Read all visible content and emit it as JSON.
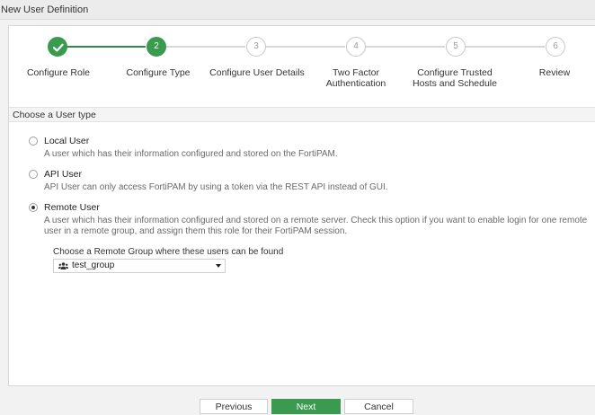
{
  "window": {
    "title": "New User Definition"
  },
  "stepper": {
    "steps": [
      {
        "number": "1",
        "label": "Configure Role",
        "state": "done"
      },
      {
        "number": "2",
        "label": "Configure Type",
        "state": "active"
      },
      {
        "number": "3",
        "label": "Configure User Details",
        "state": "todo"
      },
      {
        "number": "4",
        "label": "Two Factor\nAuthentication",
        "state": "todo"
      },
      {
        "number": "5",
        "label": "Configure Trusted\nHosts and Schedule",
        "state": "todo"
      },
      {
        "number": "6",
        "label": "Review",
        "state": "todo"
      }
    ]
  },
  "section": {
    "title": "Choose a User type"
  },
  "options": [
    {
      "label": "Local User",
      "description": "A user which has their information configured and stored on the FortiPAM.",
      "selected": false
    },
    {
      "label": "API User",
      "description": "API User can only access FortiPAM by using a token via the REST API instead of GUI.",
      "selected": false
    },
    {
      "label": "Remote User",
      "description": "A user which has their information configured and stored on a remote server. Check this option if you want to enable login for one remote user in a remote group, and assign them this role for their FortiPAM session.",
      "selected": true
    }
  ],
  "remote_group": {
    "label": "Choose a Remote Group where these users can be found",
    "selected_value": "test_group",
    "icon": "users-icon"
  },
  "buttons": {
    "previous": "Previous",
    "next": "Next",
    "cancel": "Cancel"
  },
  "colors": {
    "accent_green": "#3a9a4f",
    "inactive_gray": "#c8c8c8"
  }
}
